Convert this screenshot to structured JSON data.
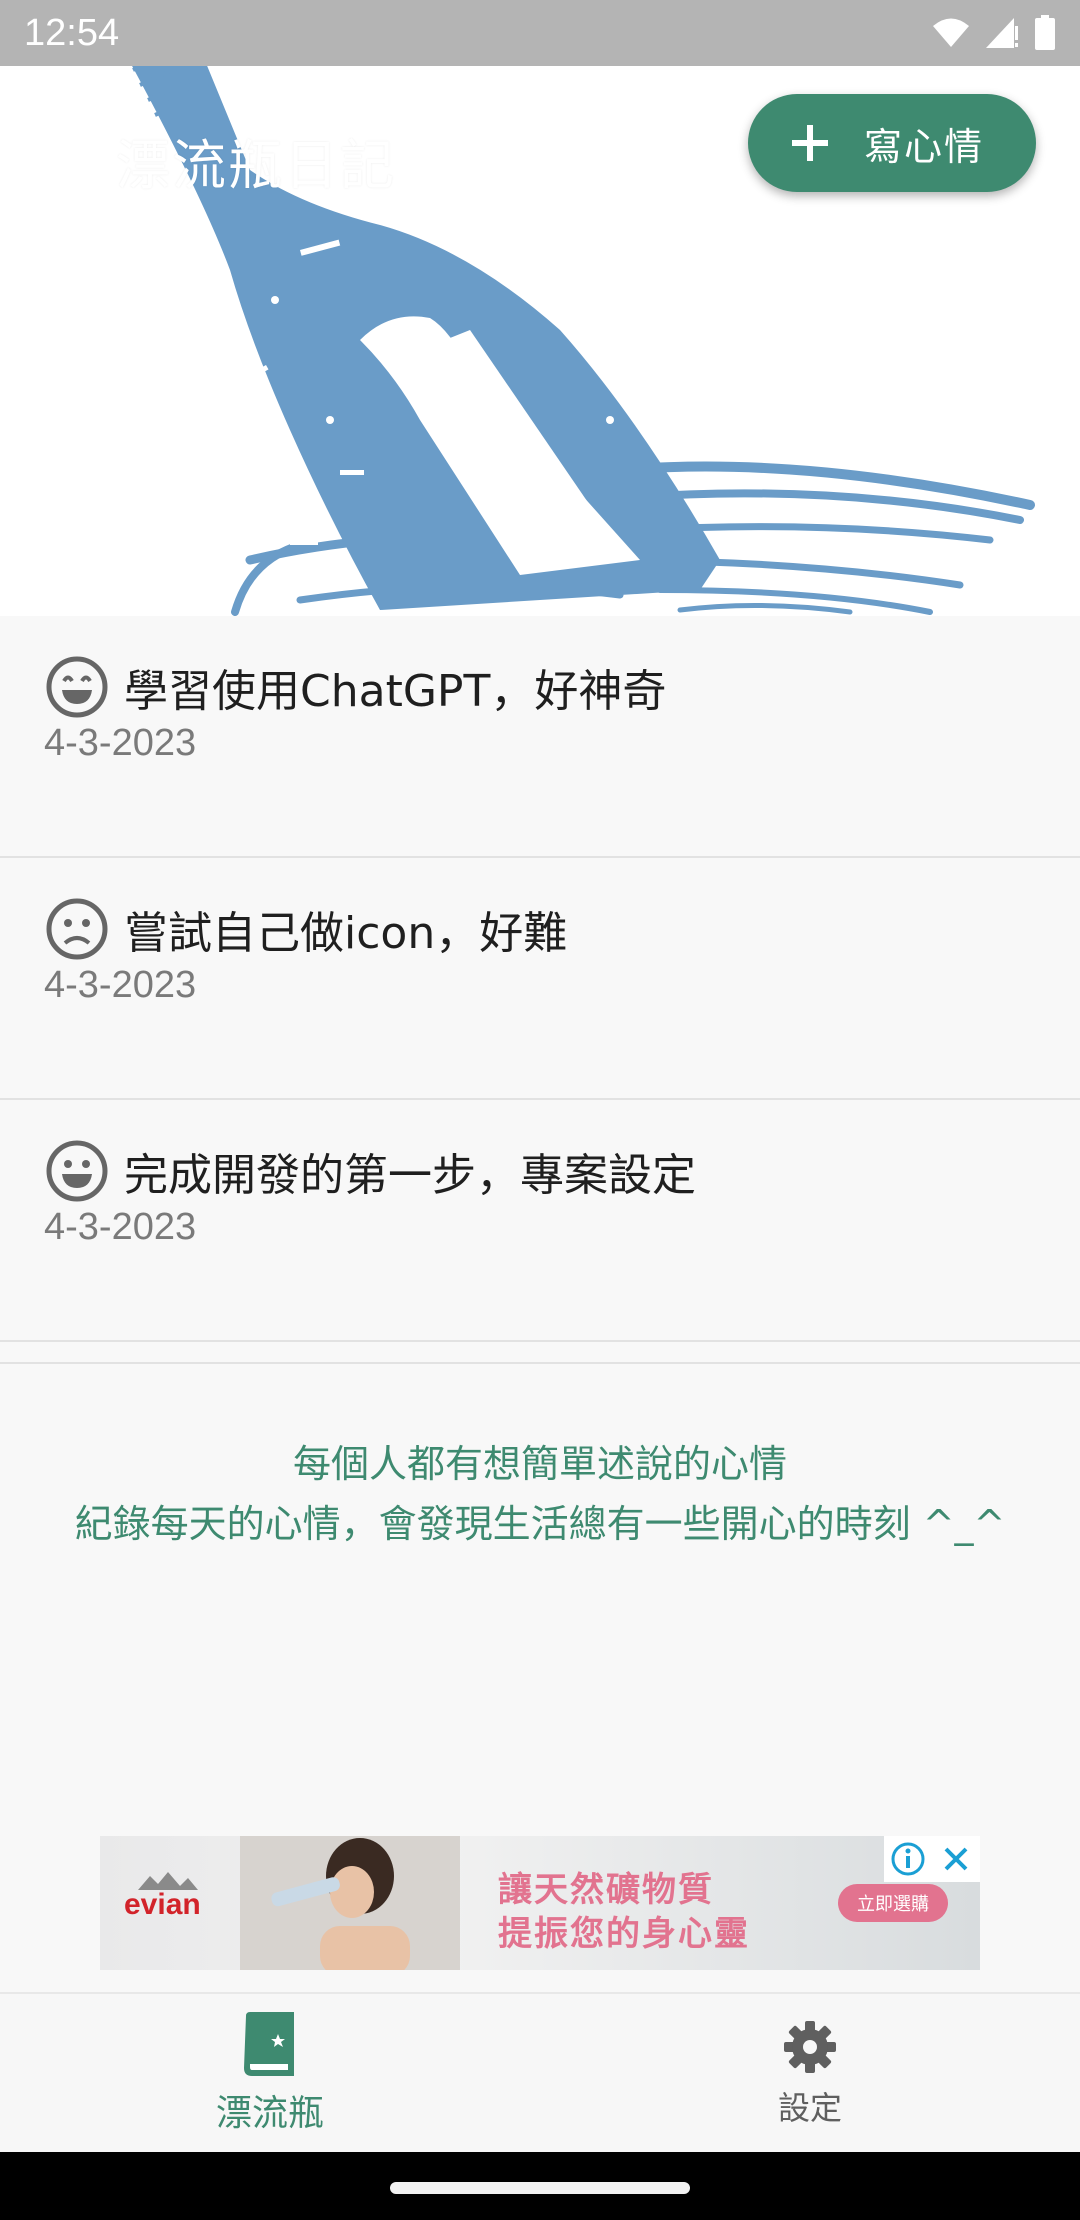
{
  "status_bar": {
    "time": "12:54",
    "icons": [
      "wifi-icon",
      "signal-icon",
      "battery-icon"
    ]
  },
  "header": {
    "title": "漂流瓶日記",
    "fab_label": "寫心情",
    "fab_icon": "plus-icon",
    "art": "bottle-illustration"
  },
  "entries": [
    {
      "mood_icon": "grin-face-icon",
      "text": "學習使用ChatGPT，好神奇",
      "date": "4-3-2023"
    },
    {
      "mood_icon": "sad-face-icon",
      "text": "嘗試自己做icon，好難",
      "date": "4-3-2023"
    },
    {
      "mood_icon": "happy-face-icon",
      "text": "完成開發的第一步，專案設定",
      "date": "4-3-2023"
    }
  ],
  "motto": {
    "line1": "每個人都有想簡單述說的心情",
    "line2": "紀錄每天的心情，會發現生活總有一些開心的時刻 ^_^"
  },
  "ad": {
    "brand": "evian",
    "line1": "讓天然礦物質",
    "line2": "提振您的身心靈",
    "cta": "立即選購"
  },
  "bottom_nav": {
    "items": [
      {
        "label": "漂流瓶",
        "icon": "journal-icon",
        "active": true
      },
      {
        "label": "設定",
        "icon": "gear-icon",
        "active": false
      }
    ]
  },
  "colors": {
    "accent": "#3e8a70",
    "bottle": "#6a9cc8",
    "status_bar": "#b4b4b4"
  }
}
